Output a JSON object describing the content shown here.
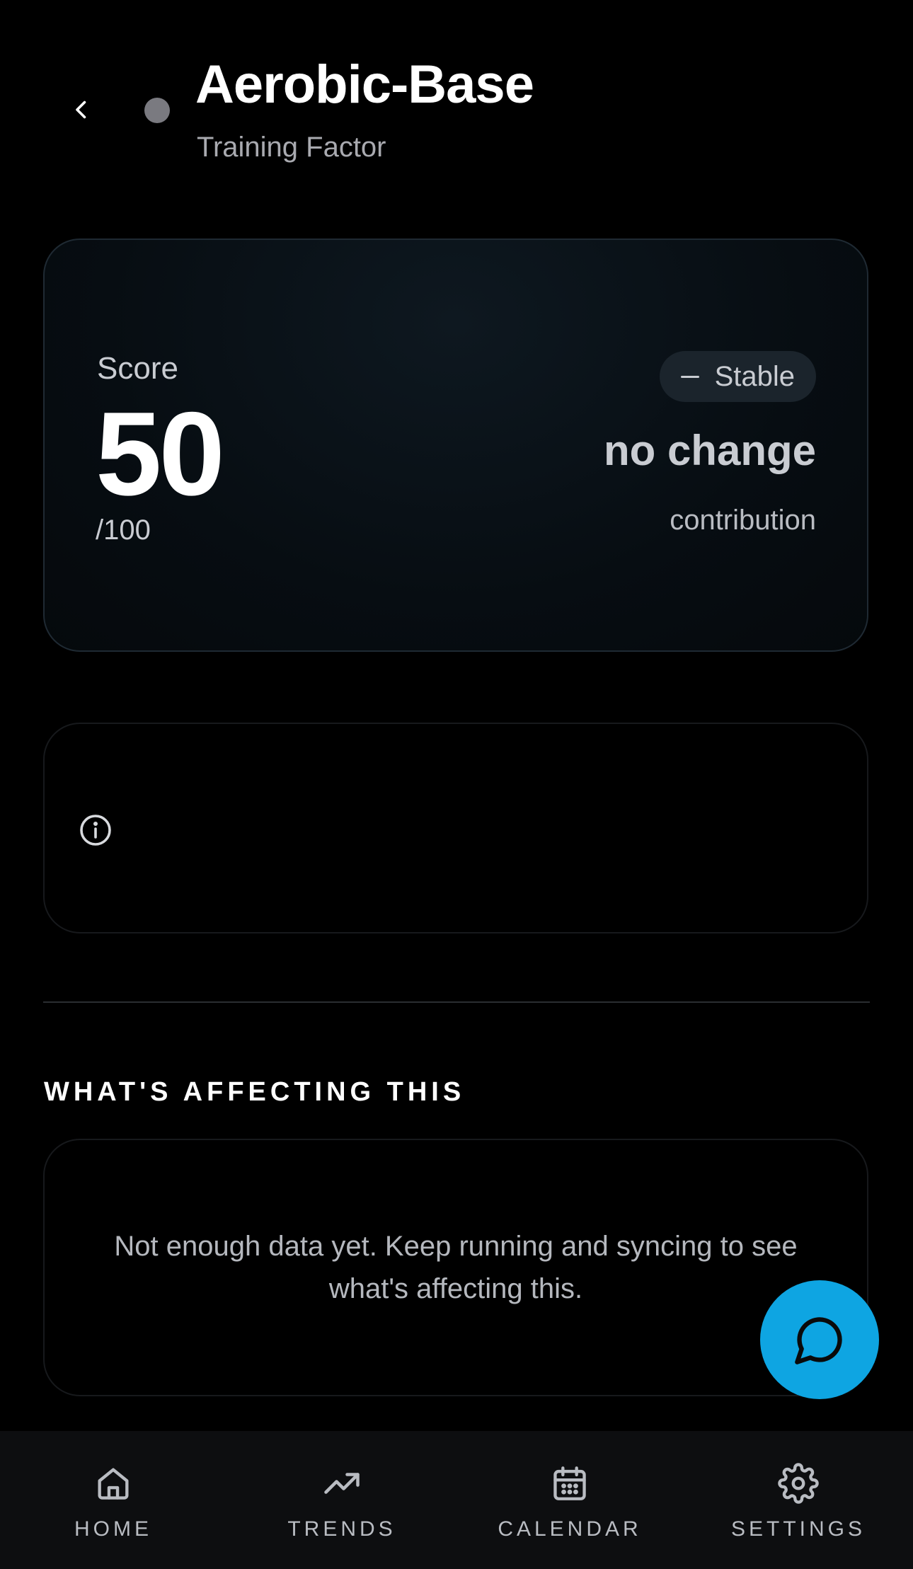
{
  "header": {
    "title": "Aerobic-Base",
    "subtitle": "Training Factor",
    "status_dot_color": "#7a7a80"
  },
  "score_card": {
    "label": "Score",
    "value": "50",
    "max": "/100",
    "trend_label": "Stable",
    "change_value": "no change",
    "change_caption": "contribution"
  },
  "affecting": {
    "heading": "WHAT'S AFFECTING THIS",
    "empty_message": "Not enough data yet. Keep running and syncing to see what's affecting this."
  },
  "colors": {
    "accent": "#0ea5e2",
    "background": "#000000",
    "nav_background": "#0d0e10"
  },
  "nav": {
    "items": [
      {
        "label": "HOME",
        "icon": "home-icon"
      },
      {
        "label": "TRENDS",
        "icon": "trending-up-icon"
      },
      {
        "label": "CALENDAR",
        "icon": "calendar-icon"
      },
      {
        "label": "SETTINGS",
        "icon": "gear-icon"
      }
    ]
  }
}
